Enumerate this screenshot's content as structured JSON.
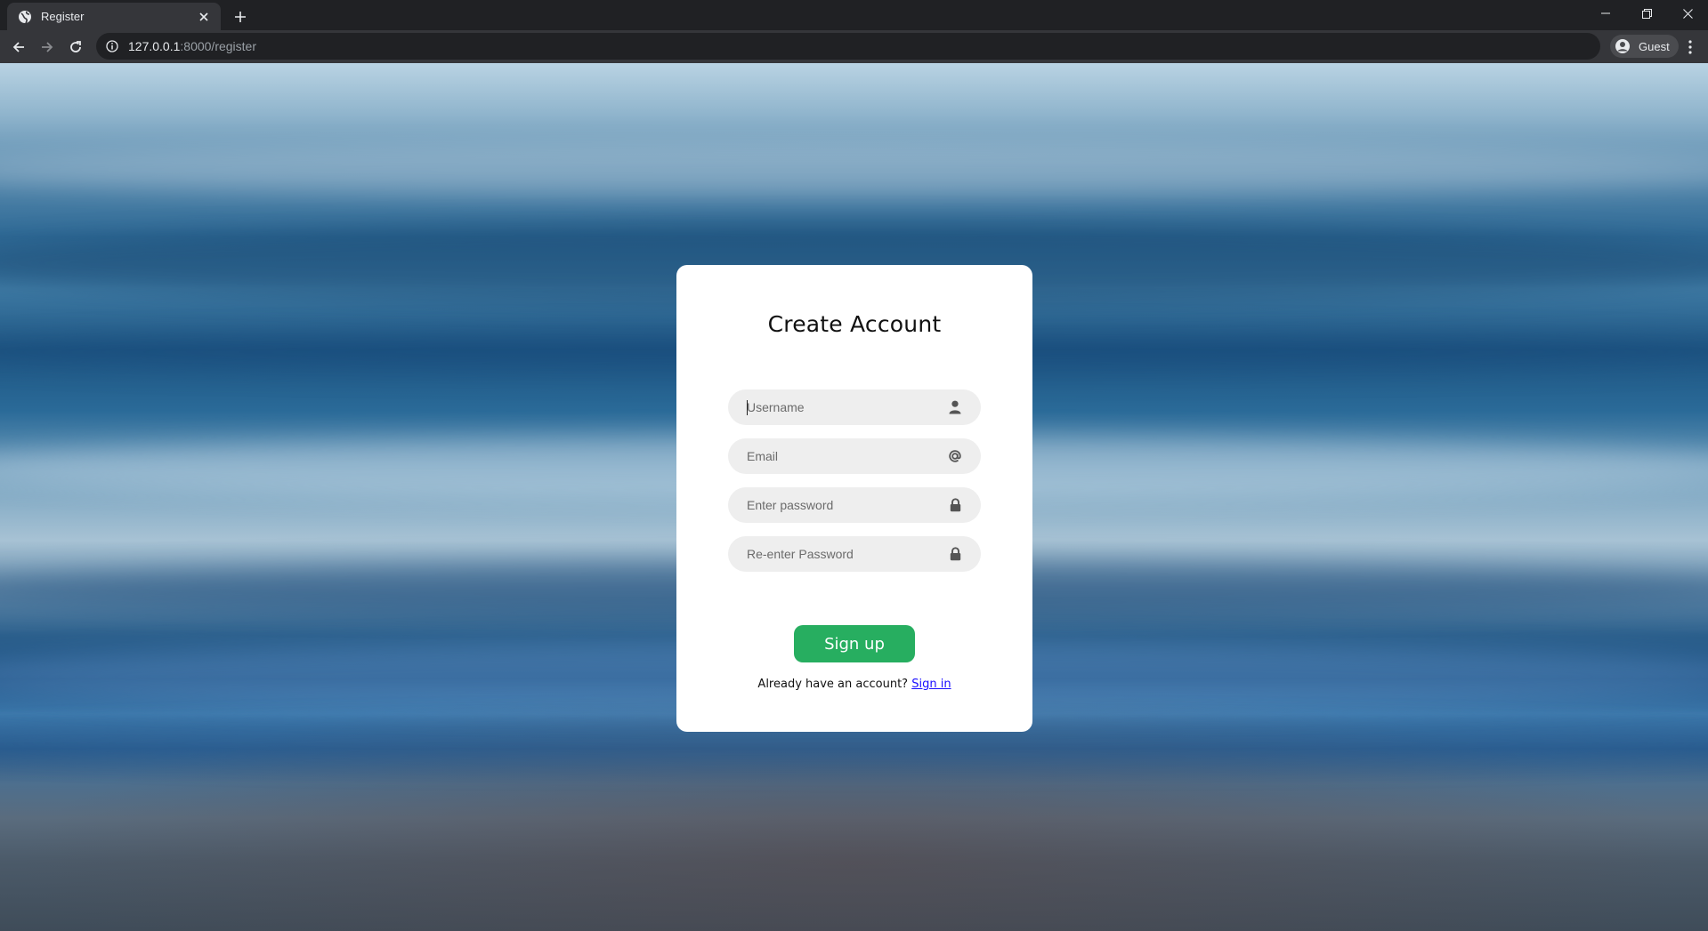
{
  "browser": {
    "tab_title": "Register",
    "url_host": "127.0.0.1",
    "url_path": ":8000/register",
    "profile_label": "Guest"
  },
  "form": {
    "title": "Create Account",
    "fields": [
      {
        "placeholder": "Username",
        "value": "",
        "icon": "user-icon"
      },
      {
        "placeholder": "Email",
        "value": "",
        "icon": "at-sign-icon"
      },
      {
        "placeholder": "Enter password",
        "value": "",
        "icon": "lock-icon"
      },
      {
        "placeholder": "Re-enter Password",
        "value": "",
        "icon": "lock-icon"
      }
    ],
    "submit_label": "Sign up",
    "signin_prompt": "Already have an account?",
    "signin_link": "Sign in"
  },
  "colors": {
    "accent": "#27ae60",
    "link": "#1a0dff",
    "field_bg": "#eeeeee",
    "card_bg": "#ffffff"
  }
}
